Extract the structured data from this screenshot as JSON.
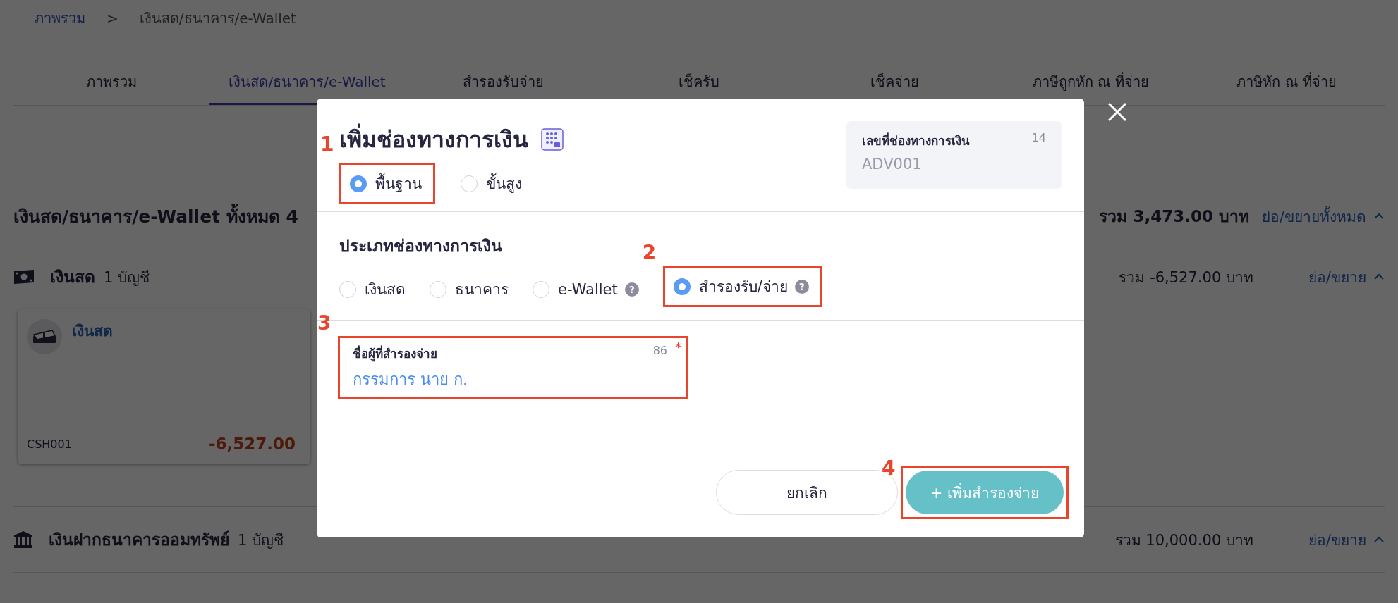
{
  "breadcrumb": [
    {
      "label": "ภาพรวม",
      "kind": "link"
    },
    {
      "label": "เงินสด/ธนาคาร/e-Wallet",
      "kind": "current"
    }
  ],
  "breadcrumb_separator": ">",
  "tabs": [
    {
      "label": "ภาพรวม",
      "selected": false
    },
    {
      "label": "เงินสด/ธนาคาร/e-Wallet",
      "selected": true
    },
    {
      "label": "สำรองรับจ่าย",
      "selected": false
    },
    {
      "label": "เช็ครับ",
      "selected": false
    },
    {
      "label": "เช็คจ่าย",
      "selected": false
    },
    {
      "label": "ภาษีถูกหัก ณ ที่จ่าย",
      "selected": false
    },
    {
      "label": "ภาษีหัก ณ ที่จ่าย",
      "selected": false
    }
  ],
  "summary": {
    "title": "เงินสด/ธนาคาร/e-Wallet ทั้งหมด 4",
    "total": "รวม 3,473.00 บาท",
    "toggle": "ย่อ/ขยายทั้งหมด",
    "expanded": true
  },
  "sections": [
    {
      "kind": "cash",
      "title": "เงินสด",
      "count": "1 บัญชี",
      "total": "รวม -6,527.00 บาท",
      "toggle": "ย่อ/ขยาย",
      "expanded": true,
      "cards": [
        {
          "name": "เงินสด",
          "code": "CSH001",
          "amount": "-6,527.00"
        }
      ]
    },
    {
      "kind": "bank",
      "title": "เงินฝากธนาคารออมทรัพย์",
      "count": "1 บัญชี",
      "total": "รวม 10,000.00 บาท",
      "toggle": "ย่อ/ขยาย",
      "expanded": true
    }
  ],
  "dialog": {
    "title": "เพิ่มช่องทางการเงิน",
    "modes": [
      {
        "label": "พื้นฐาน",
        "selected": true
      },
      {
        "label": "ขั้นสูง",
        "selected": false
      }
    ],
    "id_box": {
      "label": "เลขที่ช่องทางการเงิน",
      "count": "14",
      "value": "ADV001"
    },
    "type_label": "ประเภทช่องทางการเงิน",
    "types": [
      {
        "label": "เงินสด",
        "selected": false
      },
      {
        "label": "ธนาคาร",
        "selected": false
      },
      {
        "label": "e-Wallet",
        "selected": false,
        "help": "?"
      },
      {
        "label": "สำรองรับ/จ่าย",
        "selected": true,
        "help": "?"
      }
    ],
    "field": {
      "label": "ชื่อผู้ที่สำรองจ่าย",
      "count": "86",
      "required": "*",
      "value": "กรรมการ นาย ก."
    },
    "cancel": "ยกเลิก",
    "submit": "+ เพิ่มสำรองจ่าย",
    "steps": [
      "1",
      "2",
      "3",
      "4"
    ]
  }
}
